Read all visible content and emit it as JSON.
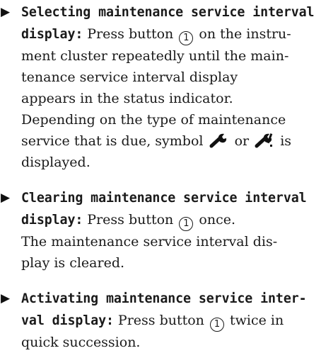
{
  "steps": [
    {
      "lead_1": "Selecting maintenance service interval",
      "lead_2": "display:",
      "t1": "Press button",
      "button": "1",
      "t2": "on the instru-",
      "l3": "ment cluster repeatedly until the main-",
      "l4": "tenance service interval display",
      "l5": "appears in the status indicator.",
      "l6": "Depending on the type of maintenance",
      "l7a": "service that is due, symbol",
      "l7b": "or",
      "l7c": "is",
      "l8": "displayed.",
      "symbol_1": "wrench-icon",
      "symbol_2": "wrench-exclamation-icon"
    },
    {
      "lead_1": "Clearing maintenance service interval",
      "lead_2": "display:",
      "t1": "Press button",
      "button": "1",
      "t2": "once.",
      "l3": "The maintenance service interval dis-",
      "l4": "play is cleared."
    },
    {
      "lead_1": "Activating maintenance service inter-",
      "lead_2": "val display:",
      "t1": "Press button",
      "button": "1",
      "t2": "twice in",
      "l3": "quick succession."
    }
  ]
}
